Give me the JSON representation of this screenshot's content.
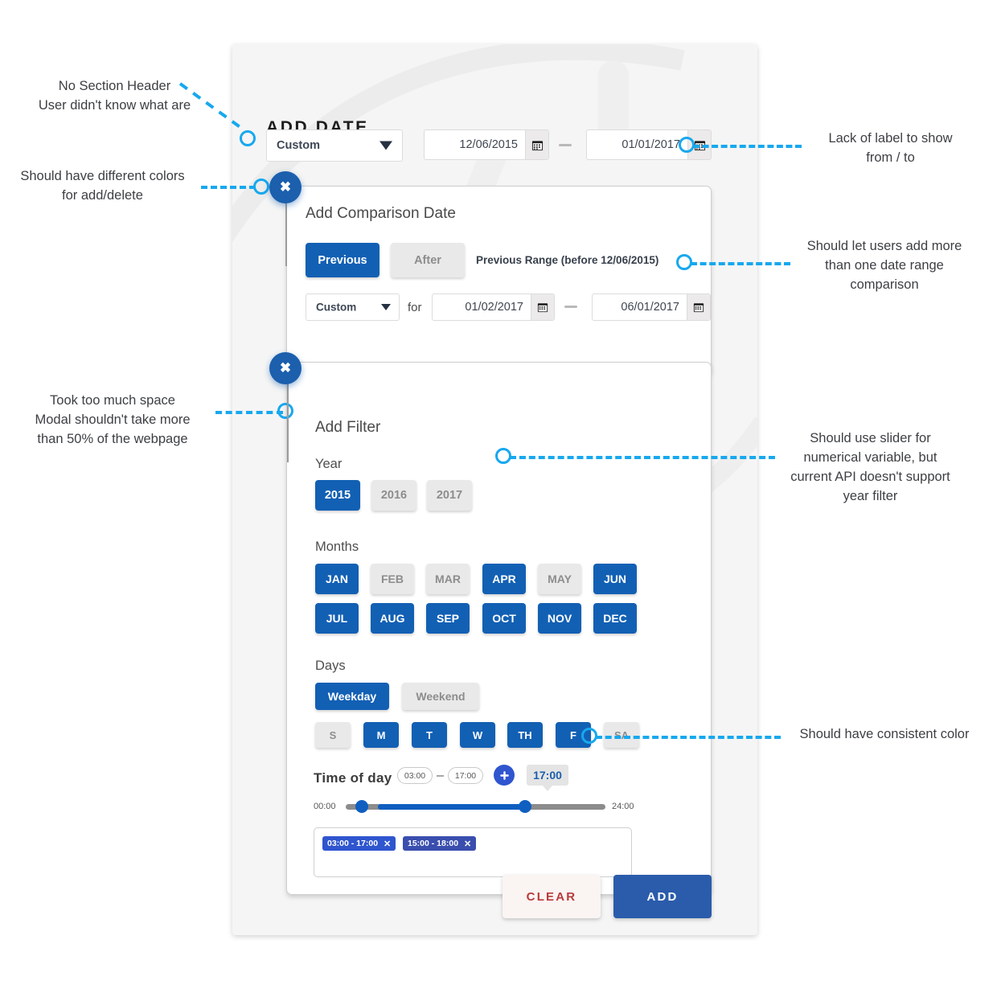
{
  "colors": {
    "accent_blue": "#1260b4",
    "annotation_blue": "#17a8ee",
    "add_button": "#2a5cab",
    "clear_text": "#b93a3a",
    "chip_blue": "#2f55cf",
    "inactive_grey": "#e9e9e9"
  },
  "header": {
    "title": "ADD DATE"
  },
  "date_row": {
    "preset": {
      "value": "Custom"
    },
    "from": {
      "value": "12/06/2015",
      "icon": "calendar-icon"
    },
    "separator": "—",
    "to": {
      "value": "01/01/2017",
      "icon": "calendar-icon"
    }
  },
  "comparison_card": {
    "title": "Add Comparison Date",
    "close_icon": "close-icon",
    "mode_buttons": [
      {
        "label": "Previous",
        "selected": true
      },
      {
        "label": "After",
        "selected": false
      }
    ],
    "range_note": "Previous Range (before 12/06/2015)",
    "preset": {
      "value": "Custom"
    },
    "for_label": "for",
    "from": {
      "value": "01/02/2017",
      "icon": "calendar-icon"
    },
    "separator": "—",
    "to": {
      "value": "06/01/2017",
      "icon": "calendar-icon"
    }
  },
  "filter_card": {
    "title": "Add Filter",
    "close_icon": "close-icon",
    "year": {
      "label": "Year",
      "options": [
        {
          "label": "2015",
          "selected": true
        },
        {
          "label": "2016",
          "selected": false
        },
        {
          "label": "2017",
          "selected": false
        }
      ]
    },
    "months": {
      "label": "Months",
      "options": [
        {
          "label": "JAN",
          "selected": true
        },
        {
          "label": "FEB",
          "selected": false
        },
        {
          "label": "MAR",
          "selected": false
        },
        {
          "label": "APR",
          "selected": true
        },
        {
          "label": "MAY",
          "selected": false
        },
        {
          "label": "JUN",
          "selected": true
        },
        {
          "label": "JUL",
          "selected": true
        },
        {
          "label": "AUG",
          "selected": true
        },
        {
          "label": "SEP",
          "selected": true
        },
        {
          "label": "OCT",
          "selected": true
        },
        {
          "label": "NOV",
          "selected": true
        },
        {
          "label": "DEC",
          "selected": true
        }
      ]
    },
    "days": {
      "label": "Days",
      "groups": [
        {
          "label": "Weekday",
          "selected": true
        },
        {
          "label": "Weekend",
          "selected": false
        }
      ],
      "weekdays": [
        {
          "label": "S",
          "selected": false
        },
        {
          "label": "M",
          "selected": true
        },
        {
          "label": "T",
          "selected": true
        },
        {
          "label": "W",
          "selected": true
        },
        {
          "label": "TH",
          "selected": true
        },
        {
          "label": "F",
          "selected": true
        },
        {
          "label": "SA",
          "selected": false
        }
      ]
    },
    "time_of_day": {
      "label": "Time of day",
      "start": "03:00",
      "separator": "–",
      "end": "17:00",
      "add_icon": "plus-icon",
      "tooltip_value": "17:00",
      "slider_min_label": "00:00",
      "slider_max_label": "24:00",
      "slider_start_pct": 12.5,
      "slider_end_pct": 70.8,
      "chips": [
        {
          "label": "03:00 - 17:00",
          "remove_icon": "close-icon",
          "color": "#2f55cf"
        },
        {
          "label": "15:00 - 18:00",
          "remove_icon": "close-icon",
          "color": "#3a4eae"
        }
      ]
    }
  },
  "footer": {
    "clear_label": "CLEAR",
    "add_label": "ADD"
  },
  "annotations": [
    {
      "id": "no-section-header",
      "text": "No Section Header\nUser didn't know what are"
    },
    {
      "id": "different-colors",
      "text": "Should have different colors\nfor add/delete"
    },
    {
      "id": "too-much-space",
      "text": "Took too much space\nModal shouldn't take more\nthan 50% of the webpage"
    },
    {
      "id": "lack-of-label",
      "text": "Lack of label to show\nfrom / to"
    },
    {
      "id": "more-comparisons",
      "text": "Should let users add more\nthan one date range\ncomparison"
    },
    {
      "id": "use-slider",
      "text": "Should use slider for\nnumerical variable, but\ncurrent API doesn't support\nyear filter"
    },
    {
      "id": "consistent-color",
      "text": "Should have consistent color"
    }
  ]
}
